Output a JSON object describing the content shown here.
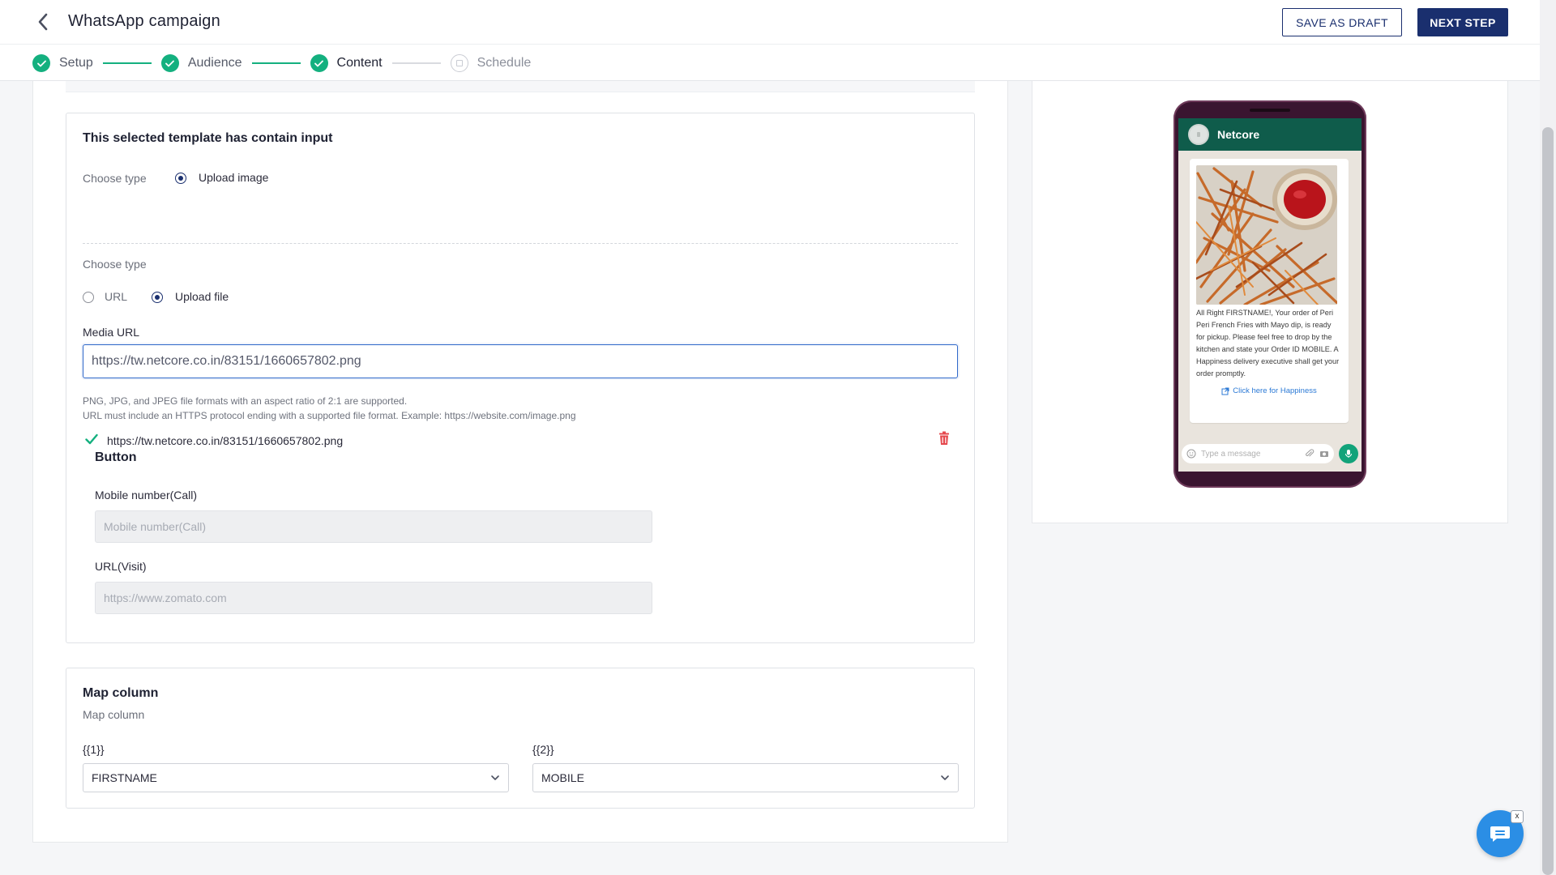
{
  "header": {
    "title": "WhatsApp campaign",
    "save_draft_label": "SAVE AS DRAFT",
    "next_step_label": "NEXT STEP"
  },
  "steps": [
    {
      "label": "Setup",
      "state": "done"
    },
    {
      "label": "Audience",
      "state": "done"
    },
    {
      "label": "Content",
      "state": "current"
    },
    {
      "label": "Schedule",
      "state": "pending"
    }
  ],
  "template_card": {
    "title": "This selected template has contain input",
    "choose_type_label": "Choose type",
    "upload_image_label": "Upload image",
    "choose_type_label_2": "Choose type",
    "url_option_label": "URL",
    "upload_file_label": "Upload file",
    "media_url_label": "Media URL",
    "media_url_value": "https://tw.netcore.co.in/83151/1660657802.png",
    "hint_line_1": "PNG, JPG, and JPEG file formats with an aspect ratio of 2:1 are supported.",
    "hint_line_2": "URL must include an HTTPS protocol ending with a supported file format. Example: https://website.com/image.png",
    "uploaded_file_url": "https://tw.netcore.co.in/83151/1660657802.png",
    "button_section_title": "Button",
    "mobile_label": "Mobile number(Call)",
    "mobile_placeholder": "Mobile number(Call)",
    "url_visit_label": "URL(Visit)",
    "url_visit_placeholder": "https://www.zomato.com"
  },
  "map_card": {
    "title": "Map column",
    "subtitle": "Map column",
    "col1_label": "{{1}}",
    "col1_value": "FIRSTNAME",
    "col2_label": "{{2}}",
    "col2_value": "MOBILE"
  },
  "preview": {
    "sender": "Netcore",
    "message": "All Right FIRSTNAME!, Your order of Peri Peri French Fries with Mayo dip, is ready for pickup. Please feel free to drop by the kitchen and state your Order ID MOBILE. A Happiness delivery executive shall get your order promptly.",
    "link_text": "Click here for Happiness",
    "input_placeholder": "Type a message"
  },
  "chat_widget": {
    "close_glyph": "x"
  },
  "colors": {
    "primary": "#1a2f6e",
    "success": "#14b07f",
    "whatsapp_header": "#0f5c4b",
    "focus_border": "#2f68c9",
    "danger": "#e5484d"
  }
}
